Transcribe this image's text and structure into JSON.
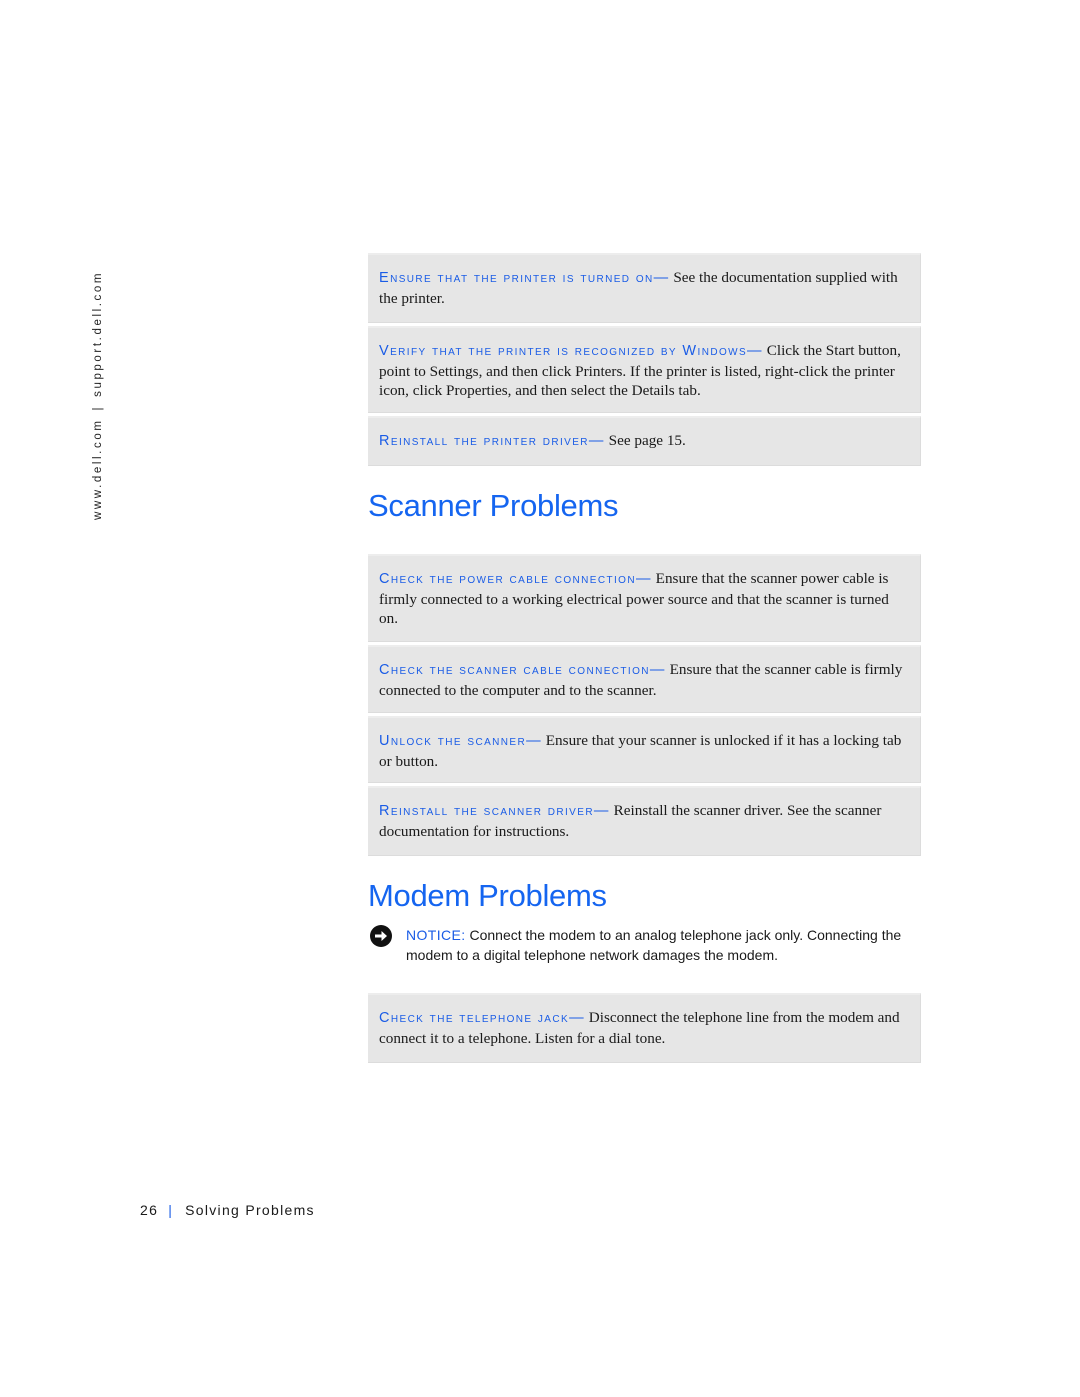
{
  "sidebar": {
    "url_left": "www.dell.com",
    "separator": "|",
    "url_right": "support.dell.com"
  },
  "printer_items": [
    {
      "lead": "Ensure that the printer is turned on—",
      "text": " See the documentation supplied with the printer."
    },
    {
      "lead": "Verify that the printer is recognized by Windows—",
      "text": " Click the Start button, point to Settings, and then click Printers. If the printer is listed, right-click the printer icon, click Properties, and then select the Details tab."
    },
    {
      "lead": "Reinstall the printer driver—",
      "text": " See page 15."
    }
  ],
  "scanner_section": {
    "title": "Scanner Problems",
    "items": [
      {
        "lead": "Check the power cable connection—",
        "text": " Ensure that the scanner power cable is firmly connected to a working electrical power source and that the scanner is turned on."
      },
      {
        "lead": "Check the scanner cable connection—",
        "text": " Ensure that the scanner cable is firmly connected to the computer and to the scanner."
      },
      {
        "lead": "Unlock the scanner—",
        "text": " Ensure that your scanner is unlocked if it has a locking tab or button."
      },
      {
        "lead": "Reinstall the scanner driver—",
        "text": " Reinstall the scanner driver. See the scanner documentation for instructions."
      }
    ]
  },
  "modem_section": {
    "title": "Modem Problems",
    "notice": {
      "icon": "arrow-right-circle-icon",
      "label": "NOTICE:",
      "text": " Connect the modem to an analog telephone jack only. Connecting the modem to a digital telephone network damages the modem."
    },
    "items": [
      {
        "lead": "Check the telephone jack—",
        "text": " Disconnect the telephone line from the modem and connect it to a telephone. Listen for a dial tone."
      }
    ]
  },
  "footer": {
    "page_number": "26",
    "separator": "|",
    "section": "Solving Problems"
  }
}
